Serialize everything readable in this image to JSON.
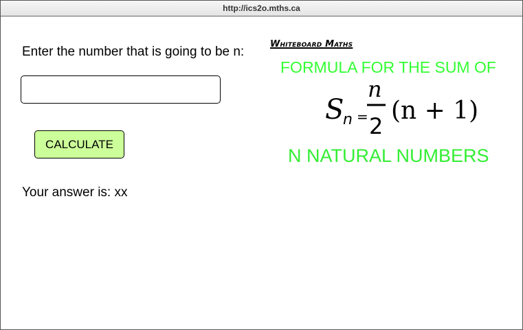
{
  "window": {
    "url": "http://ics2o.mths.ca"
  },
  "form": {
    "prompt_label": "Enter the number that is going to be n:",
    "input_value": "",
    "input_placeholder": "",
    "calculate_label": "CALCULATE",
    "answer_text": "Your answer is: xx"
  },
  "formula_image": {
    "brand": "Whiteboard Maths",
    "caption_top": "FORMULA FOR THE SUM OF",
    "caption_bottom": "N NATURAL NUMBERS",
    "formula": {
      "s": "S",
      "sub": "n",
      "eq": "=",
      "numerator": "n",
      "denominator": "2",
      "paren_expr": "(n + 1)"
    },
    "caption_color": "#33ff33"
  },
  "colors": {
    "button_bg": "#ccff99",
    "text": "#000000"
  }
}
